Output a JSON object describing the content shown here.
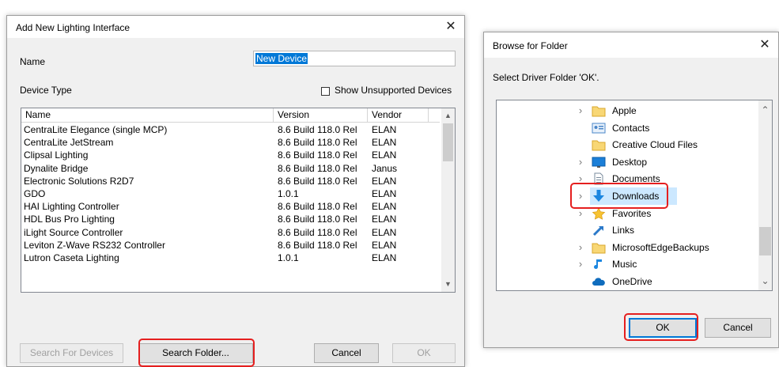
{
  "dialog1": {
    "title": "Add New Lighting Interface",
    "name_label": "Name",
    "name_value": "New Device",
    "device_type_label": "Device Type",
    "show_unsupported_label": "Show Unsupported Devices",
    "columns": [
      "Name",
      "Version",
      "Vendor"
    ],
    "rows": [
      [
        "CentraLite Elegance (single MCP)",
        "8.6 Build 118.0 Rel",
        "ELAN"
      ],
      [
        "CentraLite JetStream",
        "8.6 Build 118.0 Rel",
        "ELAN"
      ],
      [
        "Clipsal Lighting",
        "8.6 Build 118.0 Rel",
        "ELAN"
      ],
      [
        "Dynalite Bridge",
        "8.6 Build 118.0 Rel",
        "Janus"
      ],
      [
        "Electronic Solutions R2D7",
        "8.6 Build 118.0 Rel",
        "ELAN"
      ],
      [
        "GDO",
        "1.0.1",
        "ELAN"
      ],
      [
        "HAI Lighting Controller",
        "8.6 Build 118.0 Rel",
        "ELAN"
      ],
      [
        "HDL Bus Pro Lighting",
        "8.6 Build 118.0 Rel",
        "ELAN"
      ],
      [
        "iLight Source Controller",
        "8.6 Build 118.0 Rel",
        "ELAN"
      ],
      [
        "Leviton Z-Wave RS232 Controller",
        "8.6 Build 118.0 Rel",
        "ELAN"
      ],
      [
        "Lutron Caseta Lighting",
        "1.0.1",
        "ELAN"
      ]
    ],
    "buttons": {
      "search_devices": "Search For Devices",
      "search_folder": "Search Folder...",
      "cancel": "Cancel",
      "ok": "OK"
    }
  },
  "dialog2": {
    "title": "Browse for Folder",
    "instruction": "Select Driver Folder 'OK'.",
    "tree": [
      {
        "label": "Apple",
        "icon": "folder-icon",
        "expandable": true
      },
      {
        "label": "Contacts",
        "icon": "contacts-icon",
        "expandable": false
      },
      {
        "label": "Creative Cloud Files",
        "icon": "folder-icon",
        "expandable": false
      },
      {
        "label": "Desktop",
        "icon": "desktop-icon",
        "expandable": true
      },
      {
        "label": "Documents",
        "icon": "documents-icon",
        "expandable": true
      },
      {
        "label": "Downloads",
        "icon": "download-icon",
        "expandable": true,
        "selected": true
      },
      {
        "label": "Favorites",
        "icon": "star-icon",
        "expandable": true
      },
      {
        "label": "Links",
        "icon": "links-icon",
        "expandable": false
      },
      {
        "label": "MicrosoftEdgeBackups",
        "icon": "folder-icon",
        "expandable": true
      },
      {
        "label": "Music",
        "icon": "music-icon",
        "expandable": true
      },
      {
        "label": "OneDrive",
        "icon": "cloud-icon",
        "expandable": false
      }
    ],
    "buttons": {
      "ok": "OK",
      "cancel": "Cancel"
    }
  },
  "colors": {
    "accent": "#0078d7",
    "highlight": "#e51f1f",
    "selection": "#cce8ff"
  }
}
